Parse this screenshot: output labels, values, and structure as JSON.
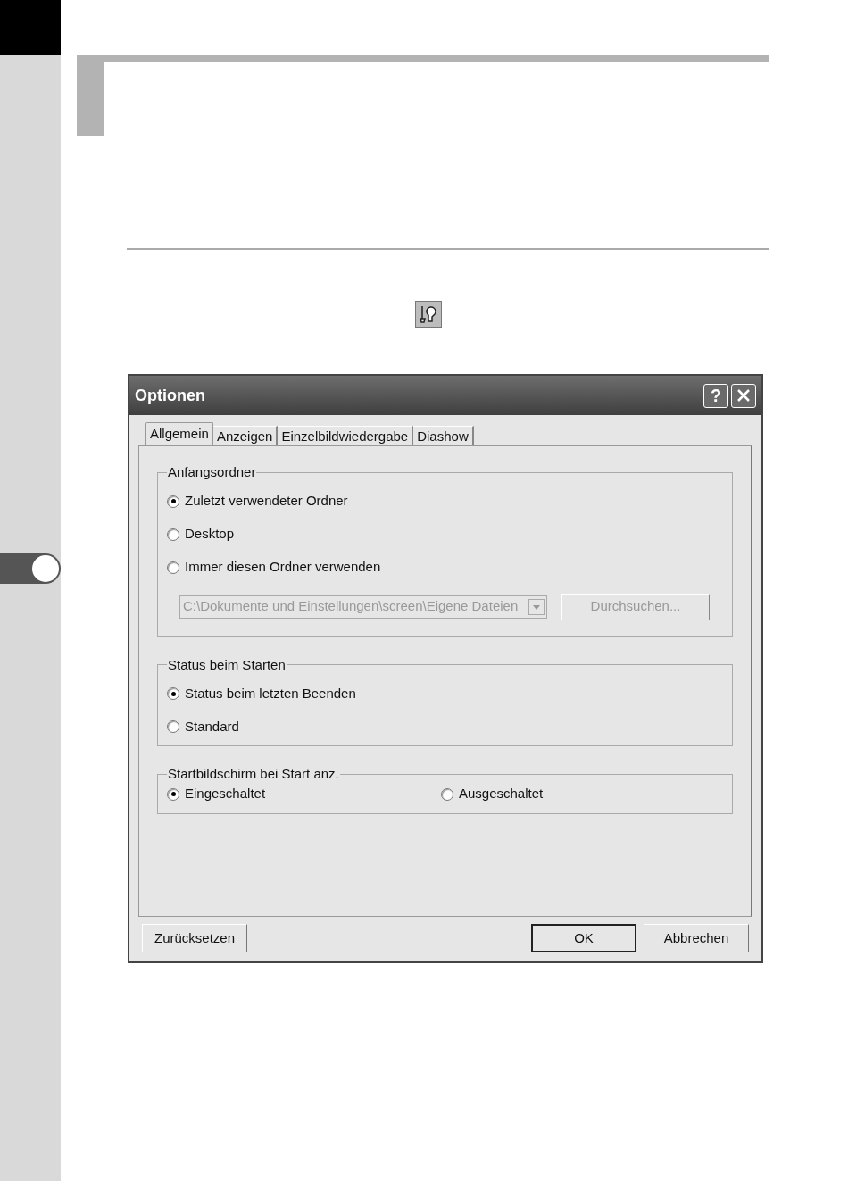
{
  "dialog": {
    "title": "Optionen",
    "help_button": "?",
    "tabs": [
      {
        "label": "Allgemein",
        "selected": true
      },
      {
        "label": "Anzeigen",
        "selected": false
      },
      {
        "label": "Einzelbildwiedergabe",
        "selected": false
      },
      {
        "label": "Diashow",
        "selected": false
      }
    ],
    "groups": [
      {
        "title": "Anfangsordner",
        "kind": "column",
        "options": [
          {
            "label": "Zuletzt verwendeter Ordner",
            "selected": true
          },
          {
            "label": "Desktop",
            "selected": false
          },
          {
            "label": "Immer diesen Ordner verwenden",
            "selected": false
          }
        ],
        "folder_field": {
          "value": "C:\\Dokumente und Einstellungen\\screen\\Eigene Dateien",
          "disabled": true
        },
        "browse_button": {
          "label": "Durchsuchen...",
          "disabled": true
        }
      },
      {
        "title": "Status beim Starten",
        "kind": "column",
        "options": [
          {
            "label": "Status beim letzten Beenden",
            "selected": true
          },
          {
            "label": "Standard",
            "selected": false
          }
        ]
      },
      {
        "title": "Startbildschirm bei Start anz.",
        "kind": "row",
        "options": [
          {
            "label": "Eingeschaltet",
            "selected": true
          },
          {
            "label": "Ausgeschaltet",
            "selected": false
          }
        ]
      }
    ],
    "buttons": [
      {
        "label": "Zurücksetzen",
        "default": false
      },
      {
        "label": "OK",
        "default": true
      },
      {
        "label": "Abbrechen",
        "default": false
      }
    ]
  }
}
